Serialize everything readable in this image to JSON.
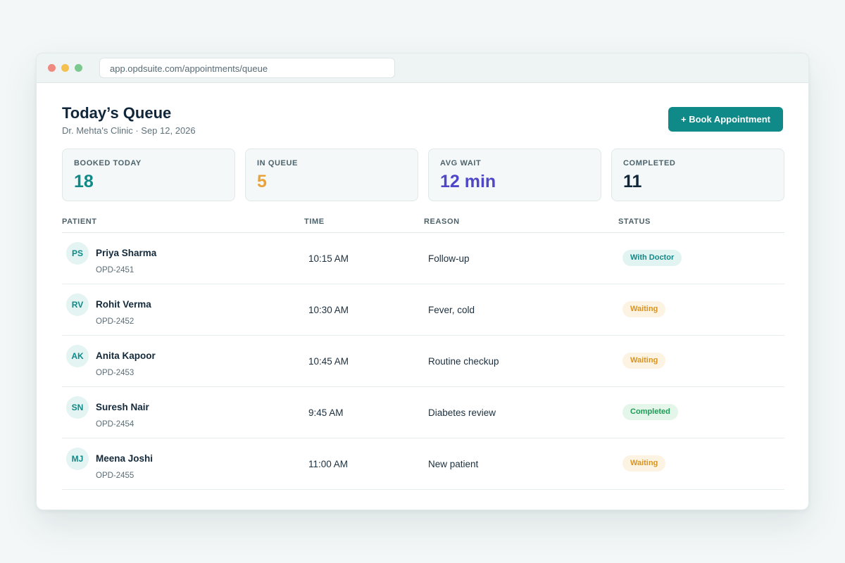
{
  "browser": {
    "url": "app.opdsuite.com/appointments/queue"
  },
  "header": {
    "title": "Today’s Queue",
    "subtitle": "Dr. Mehta's Clinic · Sep 12, 2026",
    "book_button": "+ Book Appointment"
  },
  "stats": [
    {
      "label": "BOOKED TODAY",
      "value": "18",
      "color": "#0f8a88"
    },
    {
      "label": "IN QUEUE",
      "value": "5",
      "color": "#e8a33a"
    },
    {
      "label": "AVG WAIT",
      "value": "12 min",
      "color": "#4f46c8"
    },
    {
      "label": "COMPLETED",
      "value": "11",
      "color": "#10263a"
    }
  ],
  "table": {
    "columns": [
      "PATIENT",
      "TIME",
      "REASON",
      "STATUS"
    ],
    "rows": [
      {
        "initials": "PS",
        "name": "Priya Sharma",
        "id": "OPD-2451",
        "time": "10:15 AM",
        "reason": "Follow-up",
        "status": "With Doctor",
        "status_color": "#0f8a88",
        "status_bg": "#e2f4f2"
      },
      {
        "initials": "RV",
        "name": "Rohit Verma",
        "id": "OPD-2452",
        "time": "10:30 AM",
        "reason": "Fever, cold",
        "status": "Waiting",
        "status_color": "#d9931f",
        "status_bg": "#fdf3e2"
      },
      {
        "initials": "AK",
        "name": "Anita Kapoor",
        "id": "OPD-2453",
        "time": "10:45 AM",
        "reason": "Routine checkup",
        "status": "Waiting",
        "status_color": "#d9931f",
        "status_bg": "#fdf3e2"
      },
      {
        "initials": "SN",
        "name": "Suresh Nair",
        "id": "OPD-2454",
        "time": "9:45 AM",
        "reason": "Diabetes review",
        "status": "Completed",
        "status_color": "#1f9a55",
        "status_bg": "#e4f5ea"
      },
      {
        "initials": "MJ",
        "name": "Meena Joshi",
        "id": "OPD-2455",
        "time": "11:00 AM",
        "reason": "New patient",
        "status": "Waiting",
        "status_color": "#d9931f",
        "status_bg": "#fdf3e2"
      }
    ]
  }
}
